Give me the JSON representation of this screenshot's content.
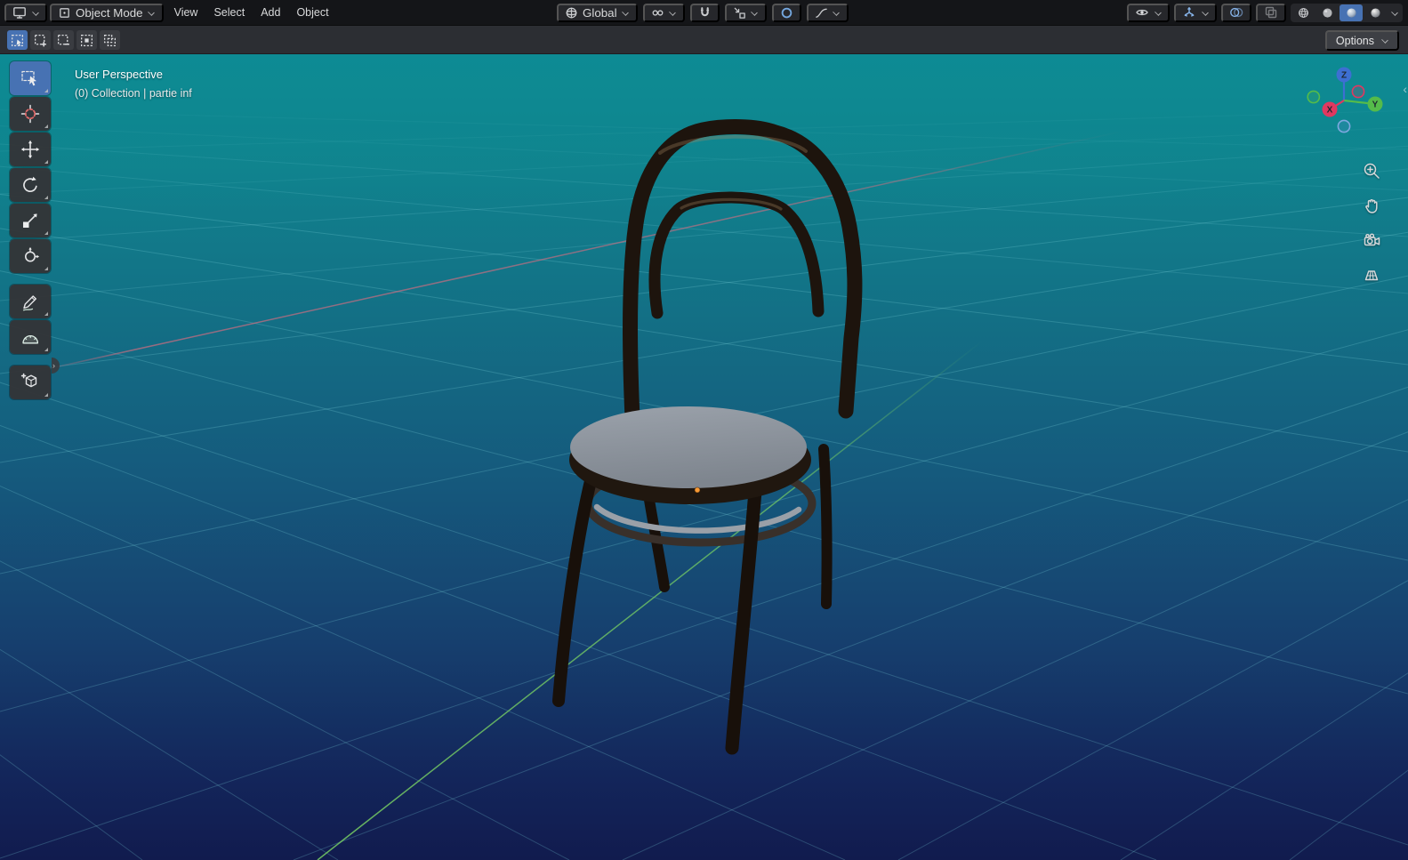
{
  "topbar": {
    "editor": {
      "icon": "viewport-editor-icon"
    },
    "mode": {
      "icon": "object-mode-icon",
      "label": "Object Mode"
    },
    "menus": [
      {
        "label": "View"
      },
      {
        "label": "Select"
      },
      {
        "label": "Add"
      },
      {
        "label": "Object"
      }
    ],
    "orientation": {
      "icon": "orientation-globe-icon",
      "label": "Global"
    },
    "pivot": {
      "icon": "pivot-point-icon"
    },
    "snap": {
      "magnet_icon": "snap-magnet-icon",
      "target_icon": "snap-target-icon"
    },
    "proportional": {
      "icon": "proportional-editing-icon",
      "falloff_icon": "proportional-falloff-icon"
    },
    "visibility": {
      "icon": "visibility-eye-icon"
    },
    "gizmos": {
      "icon": "gizmo-arrows-icon"
    },
    "overlays": {
      "icon": "overlays-icon"
    },
    "xray": {
      "icon": "xray-icon"
    },
    "shading": [
      {
        "name": "wireframe",
        "icon": "wireframe-sphere-icon",
        "active": false
      },
      {
        "name": "solid",
        "icon": "solid-sphere-icon",
        "active": false
      },
      {
        "name": "material-preview",
        "icon": "material-sphere-icon",
        "active": true
      },
      {
        "name": "rendered",
        "icon": "rendered-sphere-icon",
        "active": false
      }
    ]
  },
  "toolrow": {
    "select_modes": [
      {
        "name": "set",
        "active": true
      },
      {
        "name": "extend",
        "active": false
      },
      {
        "name": "subtract",
        "active": false
      },
      {
        "name": "invert",
        "active": false
      },
      {
        "name": "intersect",
        "active": false
      }
    ],
    "options_label": "Options"
  },
  "tools": [
    {
      "name": "select-box",
      "active": true
    },
    {
      "name": "cursor",
      "active": false
    },
    {
      "name": "move",
      "active": false
    },
    {
      "name": "rotate",
      "active": false
    },
    {
      "name": "scale",
      "active": false
    },
    {
      "name": "transform",
      "active": false
    },
    {
      "name": "annotate",
      "active": false
    },
    {
      "name": "measure",
      "active": false
    },
    {
      "name": "add-cube",
      "active": false
    }
  ],
  "viewport": {
    "header_line1": "User Perspective",
    "header_line2": "(0) Collection | partie inf",
    "scene_object": "bentwood chair",
    "gizmo_axes": {
      "x": "X",
      "y": "Y",
      "z": "Z"
    },
    "nav": [
      {
        "name": "zoom"
      },
      {
        "name": "pan"
      },
      {
        "name": "camera-view"
      },
      {
        "name": "toggle-projection"
      }
    ]
  },
  "colors": {
    "accent_blue": "#4772b3",
    "viewport_top": "#0d8b94",
    "viewport_bottom": "#111b4e",
    "axis_x": "#e06c7f",
    "axis_y": "#77cf63",
    "gizmo_x": "#e13860",
    "gizmo_y": "#55bb4a",
    "gizmo_z": "#3d6fd2",
    "grid_line": "#7dd2dc"
  }
}
